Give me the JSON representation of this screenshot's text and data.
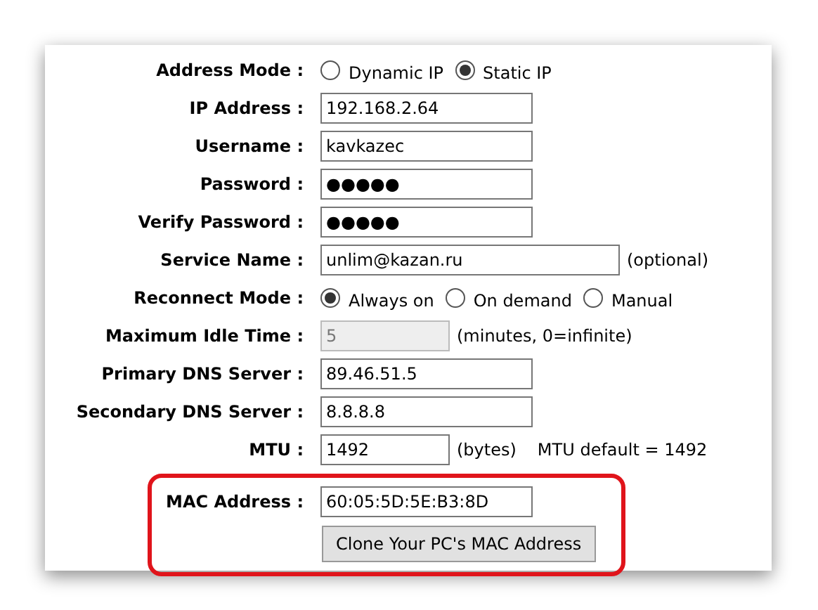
{
  "form": {
    "rows": [
      {
        "kind": "radio",
        "label": "Address Mode :",
        "options": [
          {
            "label": "Dynamic IP",
            "selected": false
          },
          {
            "label": "Static IP",
            "selected": true
          }
        ]
      },
      {
        "kind": "text",
        "label": "IP Address :",
        "value": "192.168.2.64",
        "disabled": false
      },
      {
        "kind": "text",
        "label": "Username :",
        "value": "kavkazec",
        "disabled": false
      },
      {
        "kind": "text",
        "label": "Password :",
        "value": "●●●●●",
        "disabled": false
      },
      {
        "kind": "text",
        "label": "Verify Password :",
        "value": "●●●●●",
        "disabled": false
      },
      {
        "kind": "wide",
        "label": "Service Name :",
        "value": "unlim@kazan.ru",
        "note": "(optional)",
        "disabled": false
      },
      {
        "kind": "radio",
        "label": "Reconnect Mode :",
        "options": [
          {
            "label": "Always on",
            "selected": true
          },
          {
            "label": "On demand",
            "selected": false
          },
          {
            "label": "Manual",
            "selected": false
          }
        ]
      },
      {
        "kind": "short",
        "label": "Maximum Idle Time :",
        "value": "5",
        "note": "(minutes, 0=infinite)",
        "disabled": true
      },
      {
        "kind": "text",
        "label": "Primary DNS Server :",
        "value": "89.46.51.5",
        "disabled": false
      },
      {
        "kind": "text",
        "label": "Secondary DNS Server :",
        "value": "8.8.8.8",
        "disabled": false
      },
      {
        "kind": "short",
        "label": "MTU :",
        "value": "1492",
        "note": "(bytes)",
        "extra": "MTU default = 1492",
        "disabled": false
      }
    ]
  },
  "mac_section": {
    "highlighted": true,
    "label": "MAC Address :",
    "value": "60:05:5D:5E:B3:8D",
    "button": "Clone Your PC's MAC Address"
  }
}
